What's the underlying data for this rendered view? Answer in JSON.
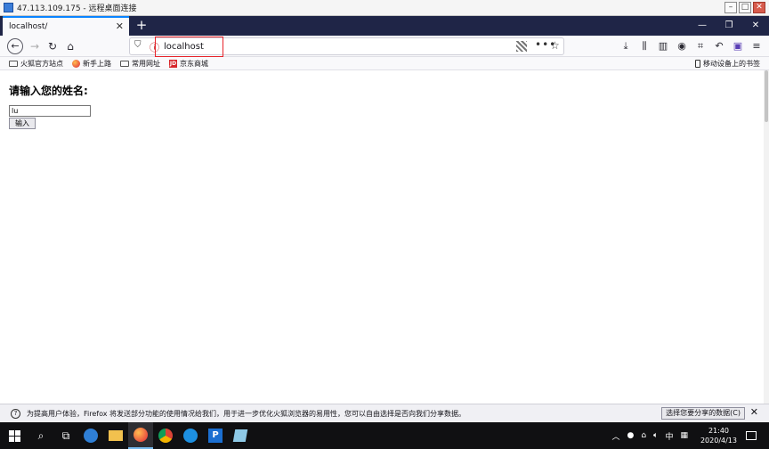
{
  "rdp": {
    "title": "47.113.109.175 - 远程桌面连接"
  },
  "browser": {
    "tab_title": "localhost/",
    "tab_close": "✕",
    "new_tab": "+",
    "url": "localhost",
    "bookmarks": [
      "火狐官方站点",
      "新手上路",
      "常用网址",
      "京东商城"
    ],
    "mobile_bookmarks": "移动设备上的书签"
  },
  "page": {
    "heading": "请输入您的姓名:",
    "name_value": "lu",
    "submit_label": "输入"
  },
  "notification": {
    "text": "为提高用户体验，Firefox 将发送部分功能的使用情况给我们，用于进一步优化火狐浏览器的易用性，您可以自由选择是否向我们分享数据。",
    "button": "选择您要分享的数据(C)"
  },
  "taskbar": {
    "ime": "中",
    "time": "21:40",
    "date": "2020/4/13"
  },
  "colors": {
    "highlight_box": "#e8232a",
    "tab_strip": "#1f2547",
    "accent": "#0a84ff"
  }
}
